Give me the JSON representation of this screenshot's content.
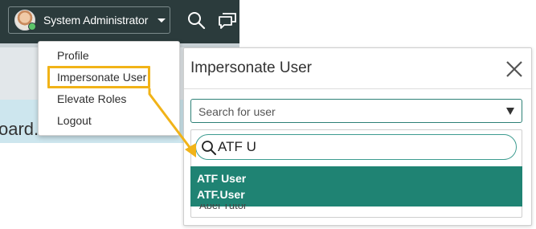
{
  "header": {
    "user_name": "System Administrator",
    "icons": {
      "search": "search-icon",
      "chat": "chat-icon",
      "caret": "chevron-down-icon"
    }
  },
  "background": {
    "partial_text": "oard."
  },
  "user_menu": {
    "items": [
      {
        "label": "Profile"
      },
      {
        "label": "Impersonate User"
      },
      {
        "label": "Elevate Roles"
      },
      {
        "label": "Logout"
      }
    ],
    "highlighted_item": "Impersonate User",
    "highlight_color": "#f1b318"
  },
  "modal": {
    "title": "Impersonate User",
    "close_icon": "close-icon",
    "select": {
      "placeholder": "Search for user"
    },
    "search": {
      "value": "ATF U"
    },
    "results": [
      {
        "name": "ATF User",
        "user_id": "ATF.User"
      }
    ],
    "next_option": "Abel Tutor"
  },
  "colors": {
    "header_bg": "#2b3b3c",
    "accent": "#1f8373",
    "annotation": "#f1b318"
  }
}
